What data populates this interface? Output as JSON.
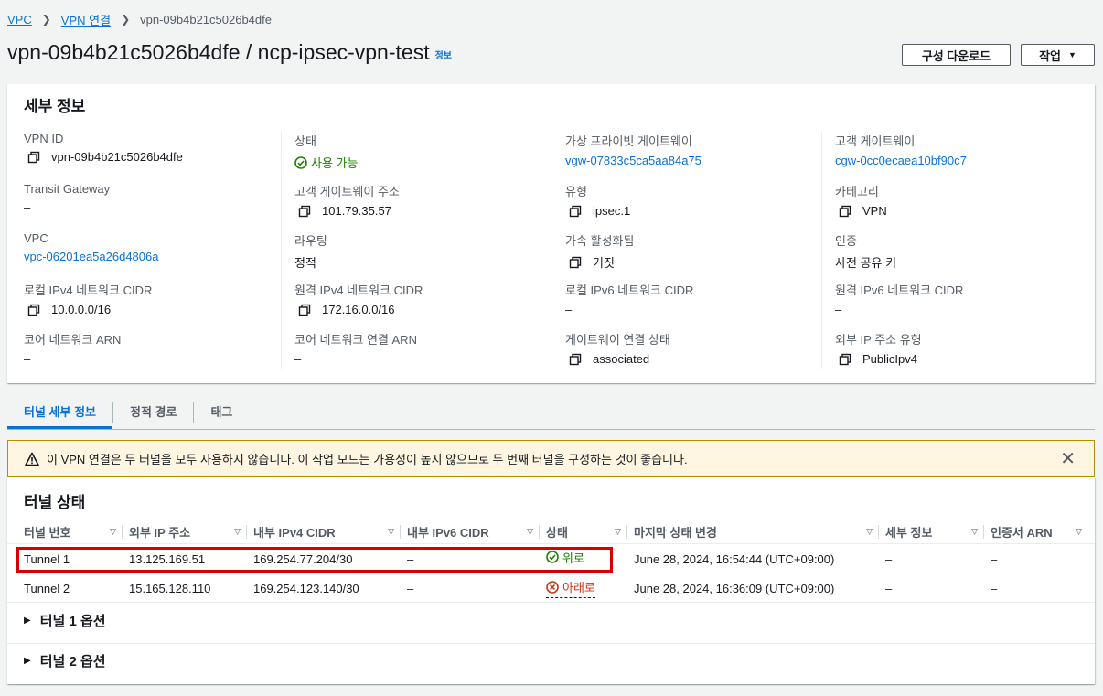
{
  "breadcrumb": {
    "vpc": "VPC",
    "vpn": "VPN 연결",
    "current": "vpn-09b4b21c5026b4dfe"
  },
  "header": {
    "title": "vpn-09b4b21c5026b4dfe / ncp-ipsec-vpn-test",
    "info": "정보",
    "config_download": "구성 다운로드",
    "actions": "작업"
  },
  "details": {
    "title": "세부 정보",
    "col1": [
      {
        "label": "VPN ID",
        "value": "vpn-09b4b21c5026b4dfe",
        "kind": "copy"
      },
      {
        "label": "Transit Gateway",
        "value": "–",
        "kind": "text"
      },
      {
        "label": "VPC",
        "value": "vpc-06201ea5a26d4806a",
        "kind": "link"
      },
      {
        "label": "로컬 IPv4 네트워크 CIDR",
        "value": "10.0.0.0/16",
        "kind": "copy"
      },
      {
        "label": "코어 네트워크 ARN",
        "value": "–",
        "kind": "text"
      }
    ],
    "col2": [
      {
        "label": "상태",
        "value": "사용 가능",
        "kind": "status"
      },
      {
        "label": "고객 게이트웨이 주소",
        "value": "101.79.35.57",
        "kind": "copy"
      },
      {
        "label": "라우팅",
        "value": "정적",
        "kind": "text"
      },
      {
        "label": "원격 IPv4 네트워크 CIDR",
        "value": "172.16.0.0/16",
        "kind": "copy"
      },
      {
        "label": "코어 네트워크 연결 ARN",
        "value": "–",
        "kind": "text"
      }
    ],
    "col3": [
      {
        "label": "가상 프라이빗 게이트웨이",
        "value": "vgw-07833c5ca5aa84a75",
        "kind": "link"
      },
      {
        "label": "유형",
        "value": "ipsec.1",
        "kind": "copy"
      },
      {
        "label": "가속 활성화됨",
        "value": "거짓",
        "kind": "copy"
      },
      {
        "label": "로컬 IPv6 네트워크 CIDR",
        "value": "–",
        "kind": "text"
      },
      {
        "label": "게이트웨이 연결 상태",
        "value": "associated",
        "kind": "copy"
      }
    ],
    "col4": [
      {
        "label": "고객 게이트웨이",
        "value": "cgw-0cc0ecaea10bf90c7",
        "kind": "link"
      },
      {
        "label": "카테고리",
        "value": "VPN",
        "kind": "copy"
      },
      {
        "label": "인증",
        "value": "사전 공유 키",
        "kind": "text"
      },
      {
        "label": "원격 IPv6 네트워크 CIDR",
        "value": "–",
        "kind": "text"
      },
      {
        "label": "외부 IP 주소 유형",
        "value": "PublicIpv4",
        "kind": "copy"
      }
    ]
  },
  "tabs": [
    "터널 세부 정보",
    "정적 경로",
    "태그"
  ],
  "alert": {
    "text": "이 VPN 연결은 두 터널을 모두 사용하지 않습니다. 이 작업 모드는 가용성이 높지 않으므로 두 번째 터널을 구성하는 것이 좋습니다."
  },
  "tunnel_state": {
    "title": "터널 상태",
    "columns": [
      "터널 번호",
      "외부 IP 주소",
      "내부 IPv4 CIDR",
      "내부 IPv6 CIDR",
      "상태",
      "마지막 상태 변경",
      "세부 정보",
      "인증서 ARN"
    ],
    "rows": [
      {
        "tunnel": "Tunnel 1",
        "outside_ip": "13.125.169.51",
        "inside_ipv4": "169.254.77.204/30",
        "inside_ipv6": "–",
        "status": "위로",
        "status_kind": "up",
        "last_change": "June 28, 2024, 16:54:44 (UTC+09:00)",
        "details": "–",
        "cert_arn": "–"
      },
      {
        "tunnel": "Tunnel 2",
        "outside_ip": "15.165.128.110",
        "inside_ipv4": "169.254.123.140/30",
        "inside_ipv6": "–",
        "status": "아래로",
        "status_kind": "down",
        "last_change": "June 28, 2024, 16:36:09 (UTC+09:00)",
        "details": "–",
        "cert_arn": "–"
      }
    ],
    "options": [
      "터널 1 옵션",
      "터널 2 옵션"
    ]
  },
  "colors": {
    "link": "#0972d3",
    "ok": "#1d8102",
    "error": "#d13212",
    "highlight": "#d50000",
    "alert_bg": "#fef6e1"
  }
}
